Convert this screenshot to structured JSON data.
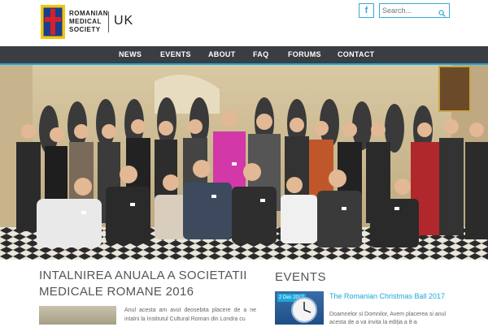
{
  "brand": {
    "lines": [
      "ROMANIAN",
      "MEDICAL",
      "SOCIETY"
    ],
    "region": "UK",
    "colors": {
      "blue": "#1a3e8c",
      "red": "#d6202c",
      "gold": "#f1c40f"
    }
  },
  "header": {
    "facebook_icon": "f",
    "search_placeholder": "Search..."
  },
  "nav": {
    "items": [
      {
        "label": "NEWS"
      },
      {
        "label": "EVENTS"
      },
      {
        "label": "ABOUT"
      },
      {
        "label": "FAQ"
      },
      {
        "label": "FORUMS"
      },
      {
        "label": "CONTACT"
      }
    ],
    "accent": "#1aa7dc"
  },
  "hero": {
    "image": "group-photo"
  },
  "article": {
    "title": "INTALNIREA ANUALA A SOCIETATII MEDICALE ROMANE 2016",
    "excerpt": "Anul acesta am avut deosebita placere de a ne intalni la Institutul Cultural Roman din Londra cu"
  },
  "events": {
    "heading": "EVENTS",
    "items": [
      {
        "date": "2 Dec 2017",
        "title": "The Romanian Christmas Ball 2017",
        "excerpt": "Doamnelor si Domnilor,   Avem placerea si anul acesta de a va invita la ediția a 8-a"
      }
    ]
  }
}
